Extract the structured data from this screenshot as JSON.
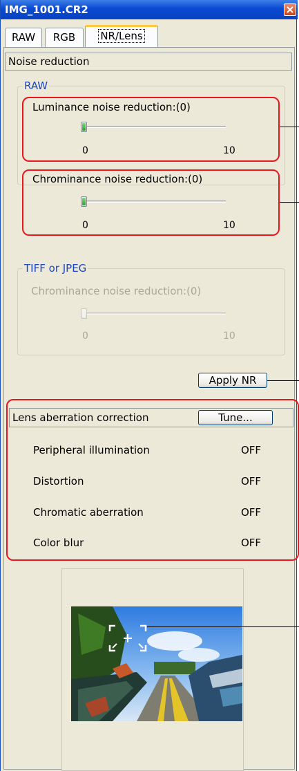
{
  "window": {
    "title": "IMG_1001.CR2"
  },
  "tabs": [
    {
      "label": "RAW",
      "active": false
    },
    {
      "label": "RGB",
      "active": false
    },
    {
      "label": "NR/Lens",
      "active": true
    }
  ],
  "noise_reduction": {
    "header": "Noise reduction",
    "raw_group": {
      "legend": "RAW",
      "luminance": {
        "label": "Luminance noise reduction:(0)",
        "min": "0",
        "max": "10",
        "value": 0
      },
      "chrominance": {
        "label": "Chrominance noise reduction:(0)",
        "min": "0",
        "max": "10",
        "value": 0
      }
    },
    "tiff_group": {
      "legend": "TIFF or JPEG",
      "chrominance": {
        "label": "Chrominance noise reduction:(0)",
        "min": "0",
        "max": "10",
        "value": 0,
        "enabled": false
      }
    },
    "apply_button": "Apply NR"
  },
  "lens": {
    "header": "Lens aberration correction",
    "tune_button": "Tune...",
    "rows": [
      {
        "label": "Peripheral illumination",
        "value": "OFF"
      },
      {
        "label": "Distortion",
        "value": "OFF"
      },
      {
        "label": "Chromatic aberration",
        "value": "OFF"
      },
      {
        "label": "Color blur",
        "value": "OFF"
      }
    ]
  },
  "colors": {
    "titlebar": "#0a4ad2",
    "panel_bg": "#ece9d8",
    "group_legend": "#1c46c8",
    "highlight_box": "#e8161e",
    "active_tab_accent": "#ffc83c",
    "slider_thumb": "#2fa32f"
  },
  "icons": {
    "close": "close-icon",
    "crosshair": "crosshair-icon"
  }
}
